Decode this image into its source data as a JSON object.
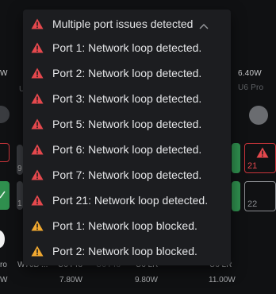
{
  "colors": {
    "error": "#e5484d",
    "warning": "#f0a830",
    "success": "#2f8f4e",
    "panel": "#1c1d20"
  },
  "background": {
    "power_left": "W",
    "power_right": "6.40W",
    "device_right": "U6 Pro",
    "port_right_error": "21",
    "port_right_idle": "22",
    "bottom_labels": [
      "ro",
      "W70B ...",
      "U6 Pro",
      "U6 Pro",
      "U6 LR",
      "U6 LR"
    ],
    "bottom_powers": [
      "W",
      "7.80W",
      "9.80W",
      "11.00W"
    ],
    "left_port_nums": [
      "9",
      "1"
    ]
  },
  "dropdown": {
    "header": {
      "label": "Multiple port issues detected",
      "icon": "error-triangle-icon",
      "chevron": "chevron-up-icon"
    },
    "items": [
      {
        "label": "Port 1: Network loop detected.",
        "severity": "error"
      },
      {
        "label": "Port 2: Network loop detected.",
        "severity": "error"
      },
      {
        "label": "Port 3: Network loop detected.",
        "severity": "error"
      },
      {
        "label": "Port 5: Network loop detected.",
        "severity": "error"
      },
      {
        "label": "Port 6: Network loop detected.",
        "severity": "error"
      },
      {
        "label": "Port 7: Network loop detected.",
        "severity": "error"
      },
      {
        "label": "Port 21: Network loop detected.",
        "severity": "error"
      },
      {
        "label": "Port 1: Network loop blocked.",
        "severity": "warning"
      },
      {
        "label": "Port 2: Network loop blocked.",
        "severity": "warning"
      }
    ]
  }
}
